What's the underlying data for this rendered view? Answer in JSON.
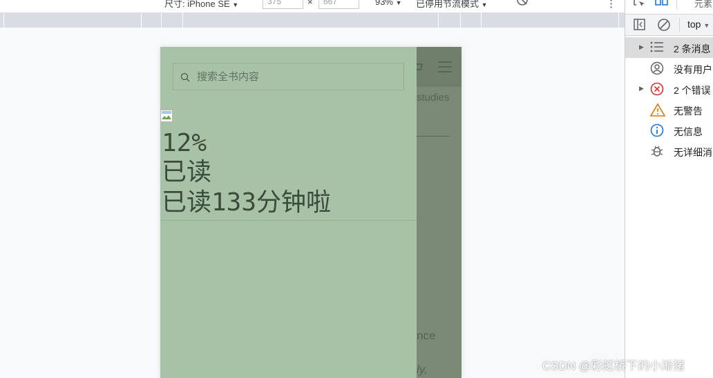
{
  "device_toolbar": {
    "dimensions_label": "尺寸: iPhone SE",
    "width_value": "375",
    "times_sign": "×",
    "height_value": "667",
    "zoom_label": "93%",
    "throttle_label": "已停用节流模式",
    "more_menu_glyph": "⋮"
  },
  "reader": {
    "search_placeholder": "搜索全书内容",
    "progress_percent": "12%",
    "read_label": "已读",
    "read_minutes_text": "已读133分钟啦",
    "behind_text_1": "studies",
    "behind_text_2": "nce",
    "behind_text_3": "ly,"
  },
  "devtools": {
    "top_tab": "元素",
    "context_select": "top",
    "messages": [
      {
        "label": "2 条消息",
        "icon": "list-icon",
        "expandable": true
      },
      {
        "label": "没有用户",
        "icon": "user-icon",
        "expandable": false
      },
      {
        "label": "2 个错误",
        "icon": "error-icon",
        "expandable": true
      },
      {
        "label": "无警告",
        "icon": "warning-icon",
        "expandable": false
      },
      {
        "label": "无信息",
        "icon": "info-icon",
        "expandable": false
      },
      {
        "label": "无详细消",
        "icon": "bug-icon",
        "expandable": false
      }
    ],
    "colors": {
      "error": "#d93025",
      "warning": "#e37400",
      "info": "#1a73e8",
      "accent": "#1a73e8"
    }
  },
  "watermark": "CSDN @彩虹桥下的小淅猪"
}
